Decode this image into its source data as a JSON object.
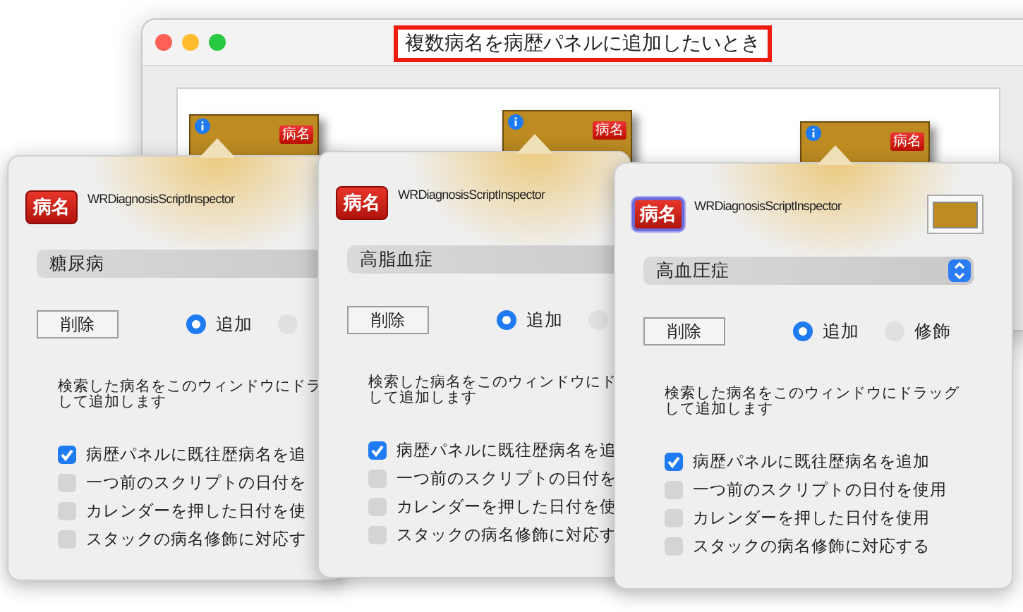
{
  "window": {
    "title": "複数病名を病歴パネルに追加したいとき",
    "cards": [
      {
        "badge": "病名"
      },
      {
        "badge": "病名"
      },
      {
        "badge": "病名"
      }
    ]
  },
  "panels": [
    {
      "badge": "病名",
      "badge_focused": false,
      "title": "WRDiagnosisScriptInspector",
      "disease": "糖尿病",
      "delete": "削除",
      "radios": [
        {
          "label": "追加",
          "selected": true
        },
        {
          "selected": false
        }
      ],
      "description": [
        "検索した病名をこのウィンドウにドラ",
        "して追加します"
      ],
      "options": [
        {
          "label": "病歴パネルに既往歴病名を追",
          "checked": true
        },
        {
          "label": "一つ前のスクリプトの日付を",
          "checked": false
        },
        {
          "label": "カレンダーを押した日付を使",
          "checked": false
        },
        {
          "label": "スタックの病名修飾に対応す",
          "checked": false
        }
      ]
    },
    {
      "badge": "病名",
      "badge_focused": false,
      "title": "WRDiagnosisScriptInspector",
      "disease": "高脂血症",
      "delete": "削除",
      "radios": [
        {
          "label": "追加",
          "selected": true
        },
        {
          "selected": false
        }
      ],
      "description": [
        "検索した病名をこのウィンドウにド",
        "して追加します"
      ],
      "options": [
        {
          "label": "病歴パネルに既往歴病名を追",
          "checked": true
        },
        {
          "label": "一つ前のスクリプトの日付を",
          "checked": false
        },
        {
          "label": "カレンダーを押した日付を使",
          "checked": false
        },
        {
          "label": "スタックの病名修飾に対応す",
          "checked": false
        }
      ]
    },
    {
      "badge": "病名",
      "badge_focused": true,
      "title": "WRDiagnosisScriptInspector",
      "color_well": true,
      "disease": "高血圧症",
      "stepper": true,
      "delete": "削除",
      "radios": [
        {
          "label": "追加",
          "selected": true
        },
        {
          "label": "修飾",
          "selected": false
        }
      ],
      "description": [
        "検索した病名をこのウィンドウにドラッグ",
        "して追加します"
      ],
      "options": [
        {
          "label": "病歴パネルに既往歴病名を追加",
          "checked": true
        },
        {
          "label": "一つ前のスクリプトの日付を使用",
          "checked": false
        },
        {
          "label": "カレンダーを押した日付を使用",
          "checked": false
        },
        {
          "label": "スタックの病名修飾に対応する",
          "checked": false
        }
      ]
    }
  ]
}
